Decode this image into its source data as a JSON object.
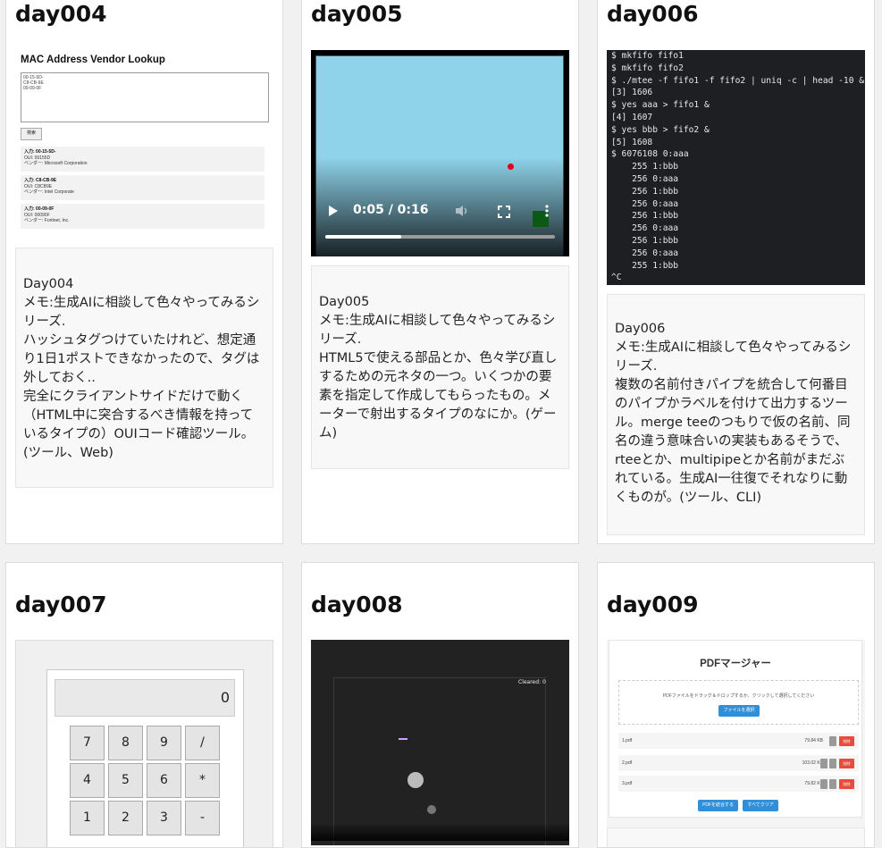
{
  "cards": [
    {
      "title": "day004",
      "desc": [
        "Day004",
        "メモ:生成AIに相談して色々やってみるシリーズ.",
        "ハッシュタグつけていたけれど、想定通り1日1ポストできなかったので、タグは外しておく..",
        "完全にクライアントサイドだけで動く（HTML中に突合するべき情報を持っているタイプの）OUIコード確認ツール。(ツール、Web)"
      ]
    },
    {
      "title": "day005",
      "desc": [
        "Day005",
        "メモ:生成AIに相談して色々やってみるシリーズ.",
        "HTML5で使える部品とか、色々学び直しするための元ネタの一つ。いくつかの要素を指定して作成してもらったもの。メーターで射出するタイプのなにか。(ゲーム)"
      ]
    },
    {
      "title": "day006",
      "desc": [
        "Day006",
        "メモ:生成AIに相談して色々やってみるシリーズ.",
        "複数の名前付きパイプを統合して何番目のパイプかラベルを付けて出力するツール。merge teeのつもりで仮の名前、同名の違う意味合いの実装もあるそうで、rteeとか、multipipeとか名前がまだぶれている。生成AI一往復でそれなりに動くものが。(ツール、CLI)"
      ]
    },
    {
      "title": "day007"
    },
    {
      "title": "day008"
    },
    {
      "title": "day009"
    }
  ],
  "mac_lookup": {
    "heading": "MAC Address Vendor Lookup",
    "textarea_value": "00-15-5D-\nC8-CB-9E\n00-09-0F",
    "button_label": "検索",
    "results": [
      {
        "input": "入力: 00-15-5D-",
        "oui": "OUI: 00155D",
        "vendor": "ベンダー: Microsoft Corporation"
      },
      {
        "input": "入力: C8-CB-9E",
        "oui": "OUI: C8CB9E",
        "vendor": "ベンダー: Intel Corporate"
      },
      {
        "input": "入力: 00-09-0F",
        "oui": "OUI: 00090F",
        "vendor": "ベンダー: Fortinet, Inc."
      }
    ]
  },
  "video": {
    "time": "0:05 / 0:16",
    "progress": 0.33,
    "play_icon": "play-icon",
    "volume_icon": "volume-icon",
    "fullscreen_icon": "fullscreen-icon",
    "menu_icon": "more-vert-icon"
  },
  "terminal": {
    "lines": [
      "$ mkfifo fifo1",
      "$ mkfifo fifo2",
      "$ ./mtee -f fifo1 -f fifo2 | uniq -c | head -10 &",
      "[3] 1606",
      "$ yes aaa > fifo1 &",
      "[4] 1607",
      "$ yes bbb > fifo2 &",
      "[5] 1608",
      "$ 6076108 0:aaa",
      "    255 1:bbb",
      "    256 0:aaa",
      "    256 1:bbb",
      "    256 0:aaa",
      "    256 1:bbb",
      "    256 0:aaa",
      "    256 1:bbb",
      "    256 0:aaa",
      "    255 1:bbb",
      "^C"
    ]
  },
  "calculator": {
    "display": "0",
    "keys": [
      "7",
      "8",
      "9",
      "/",
      "4",
      "5",
      "6",
      "*",
      "1",
      "2",
      "3",
      "-"
    ]
  },
  "game": {
    "cleared": "Cleared: 0"
  },
  "pdf": {
    "title": "PDFマージャー",
    "drop_text": "PDFファイルをドラッグ＆ドロップするか、クリックして選択してください",
    "select_button": "ファイルを選択",
    "files": [
      {
        "name": "1.pdf",
        "size": "79.84 KB",
        "delete": "削除"
      },
      {
        "name": "2.pdf",
        "size": "103.02 KB",
        "delete": "削除"
      },
      {
        "name": "3.pdf",
        "size": "79.82 KB",
        "delete": "削除"
      }
    ],
    "merge_button": "PDFを結合する",
    "clear_button": "すべてクリア"
  }
}
